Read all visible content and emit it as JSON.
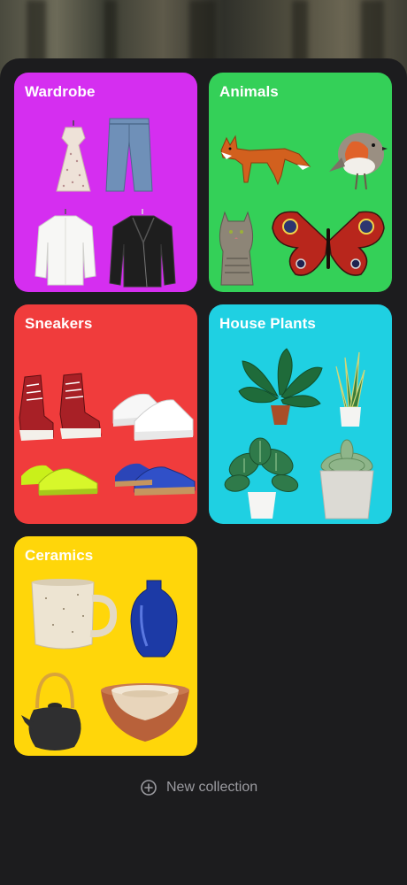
{
  "collections": [
    {
      "title": "Wardrobe",
      "color": "#d52ef0",
      "items": [
        "dress-icon",
        "jeans-icon",
        "white-shirt-icon",
        "leather-jacket-icon"
      ]
    },
    {
      "title": "Animals",
      "color": "#34d058",
      "items": [
        "fox-icon",
        "robin-icon",
        "cat-icon",
        "butterfly-icon"
      ]
    },
    {
      "title": "Sneakers",
      "color": "#f03c3c",
      "items": [
        "red-hightop-sneakers-icon",
        "white-sneakers-icon",
        "neon-running-shoes-icon",
        "blue-suede-sneakers-icon"
      ]
    },
    {
      "title": "House Plants",
      "color": "#1fd0e2",
      "items": [
        "monstera-icon",
        "snake-plant-icon",
        "calathea-icon",
        "succulent-icon"
      ]
    },
    {
      "title": "Ceramics",
      "color": "#ffd60a",
      "items": [
        "mug-icon",
        "blue-vase-icon",
        "teapot-icon",
        "nesting-bowls-icon"
      ]
    }
  ],
  "new_collection": {
    "label": "New collection",
    "icon": "plus-circle-icon"
  }
}
